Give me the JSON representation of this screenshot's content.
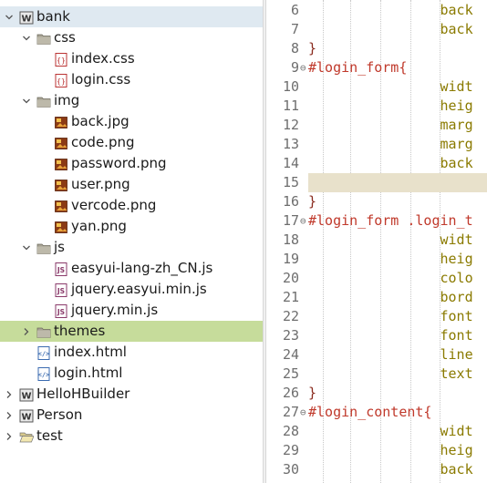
{
  "explorer": {
    "items": [
      {
        "label": "bank",
        "icon": "project-icon",
        "twisty": "expanded"
      },
      {
        "label": "css",
        "icon": "folder-icon",
        "twisty": "expanded"
      },
      {
        "label": "index.css",
        "icon": "css-file-icon",
        "twisty": ""
      },
      {
        "label": "login.css",
        "icon": "css-file-icon",
        "twisty": ""
      },
      {
        "label": "img",
        "icon": "folder-icon",
        "twisty": "expanded"
      },
      {
        "label": "back.jpg",
        "icon": "image-file-icon",
        "twisty": ""
      },
      {
        "label": "code.png",
        "icon": "image-file-icon",
        "twisty": ""
      },
      {
        "label": "password.png",
        "icon": "image-file-icon",
        "twisty": ""
      },
      {
        "label": "user.png",
        "icon": "image-file-icon",
        "twisty": ""
      },
      {
        "label": "vercode.png",
        "icon": "image-file-icon",
        "twisty": ""
      },
      {
        "label": "yan.png",
        "icon": "image-file-icon",
        "twisty": ""
      },
      {
        "label": "js",
        "icon": "folder-icon",
        "twisty": "expanded"
      },
      {
        "label": "easyui-lang-zh_CN.js",
        "icon": "js-file-icon",
        "twisty": ""
      },
      {
        "label": "jquery.easyui.min.js",
        "icon": "js-file-icon",
        "twisty": ""
      },
      {
        "label": "jquery.min.js",
        "icon": "js-file-icon",
        "twisty": ""
      },
      {
        "label": "themes",
        "icon": "folder-icon",
        "twisty": "collapsed"
      },
      {
        "label": "index.html",
        "icon": "html-file-icon",
        "twisty": ""
      },
      {
        "label": "login.html",
        "icon": "html-file-icon",
        "twisty": ""
      },
      {
        "label": "HelloHBuilder",
        "icon": "project-icon",
        "twisty": "collapsed"
      },
      {
        "label": "Person",
        "icon": "project-icon",
        "twisty": "collapsed"
      },
      {
        "label": "test",
        "icon": "open-folder-icon",
        "twisty": "collapsed"
      }
    ]
  },
  "editor": {
    "lines": [
      {
        "n": "6",
        "fold": "",
        "text": "                back"
      },
      {
        "n": "7",
        "fold": "",
        "text": "                back"
      },
      {
        "n": "8",
        "fold": "",
        "text": "}"
      },
      {
        "n": "9",
        "fold": "⊖",
        "text": "#login_form{"
      },
      {
        "n": "10",
        "fold": "",
        "text": "                widt"
      },
      {
        "n": "11",
        "fold": "",
        "text": "                heig"
      },
      {
        "n": "12",
        "fold": "",
        "text": "                marg"
      },
      {
        "n": "13",
        "fold": "",
        "text": "                marg"
      },
      {
        "n": "14",
        "fold": "",
        "text": "                back"
      },
      {
        "n": "15",
        "fold": "",
        "text": ""
      },
      {
        "n": "16",
        "fold": "",
        "text": "}"
      },
      {
        "n": "17",
        "fold": "⊖",
        "text": "#login_form .login_t"
      },
      {
        "n": "18",
        "fold": "",
        "text": "                widt"
      },
      {
        "n": "19",
        "fold": "",
        "text": "                heig"
      },
      {
        "n": "20",
        "fold": "",
        "text": "                colo"
      },
      {
        "n": "21",
        "fold": "",
        "text": "                bord"
      },
      {
        "n": "22",
        "fold": "",
        "text": "                font"
      },
      {
        "n": "23",
        "fold": "",
        "text": "                font"
      },
      {
        "n": "24",
        "fold": "",
        "text": "                line"
      },
      {
        "n": "25",
        "fold": "",
        "text": "                text"
      },
      {
        "n": "26",
        "fold": "",
        "text": "}"
      },
      {
        "n": "27",
        "fold": "⊖",
        "text": "#login_content{"
      },
      {
        "n": "28",
        "fold": "",
        "text": "                widt"
      },
      {
        "n": "29",
        "fold": "",
        "text": "                heig"
      },
      {
        "n": "30",
        "fold": "",
        "text": "                back"
      }
    ]
  },
  "colors": {
    "selection": "#c6dc9b",
    "current_line": "#e8e1cb",
    "selector": "#c0392b",
    "property": "#8a7a00"
  }
}
